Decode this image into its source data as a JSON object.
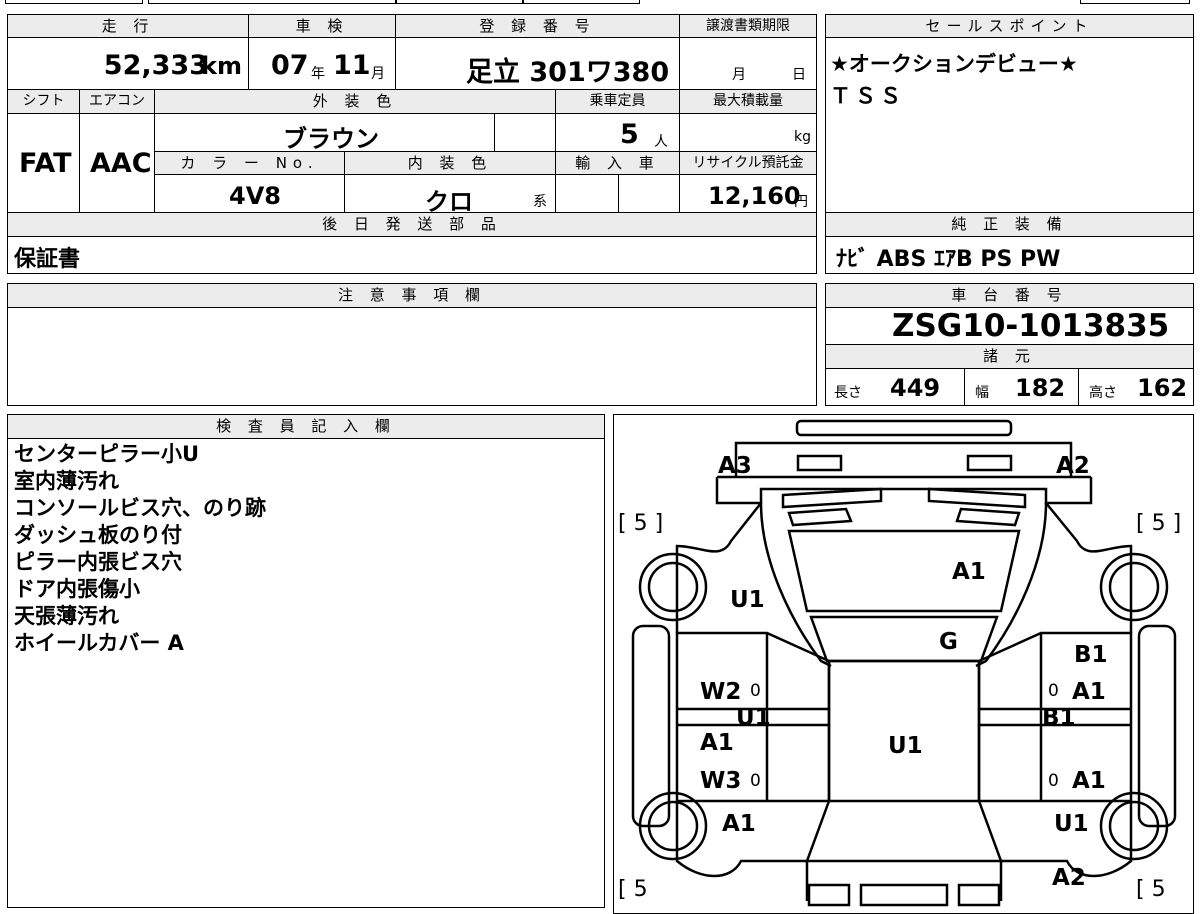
{
  "headers": {
    "mileage": "走 行",
    "inspection": "車 検",
    "registration": "登 録 番 号",
    "transfer_deadline": "譲渡書類期限",
    "sales_points": "セールスポイント",
    "shift": "シフト",
    "aircon": "エアコン",
    "exterior_color": "外 装 色",
    "capacity": "乗車定員",
    "max_load": "最大積載量",
    "color_no": "カ ラ ー No.",
    "interior_color": "内 装 色",
    "import": "輸 入 車",
    "recycle": "リサイクル預託金",
    "later_parts": "後 日 発 送 部 品",
    "genuine_equipment": "純 正 装 備",
    "notes": "注 意 事 項 欄",
    "chassis_number": "車 台 番 号",
    "specs": "諸 元",
    "inspector_notes": "検 査 員 記 入 欄"
  },
  "vehicle": {
    "mileage": "52,333",
    "mileage_unit": "km",
    "inspection_year": "07",
    "year_unit": "年",
    "inspection_month": "11",
    "month_unit": "月",
    "registration": "足立 301ワ380",
    "deadline_month_unit": "月",
    "deadline_day_unit": "日",
    "shift": "FAT",
    "aircon": "AAC",
    "exterior_color": "ブラウン",
    "capacity": "5",
    "capacity_unit": "人",
    "max_load_unit": "kg",
    "color_no": "4V8",
    "interior_color": "クロ",
    "interior_suffix": "系",
    "recycle_fee": "12,160",
    "recycle_unit": "円",
    "later_parts": "保証書",
    "chassis_number": "ZSG10-1013835",
    "length_label": "長さ",
    "length": "449",
    "width_label": "幅",
    "width": "182",
    "height_label": "高さ",
    "height": "162"
  },
  "sales_points": [
    "★オークションデビュー★",
    "ＴＳＳ"
  ],
  "equipment": "ﾅﾋﾞ ABS ｴｱB PS PW",
  "inspector_notes": [
    "センターピラー小U",
    "室内薄汚れ",
    "コンソールビス穴、のり跡",
    "ダッシュ板のり付",
    "ピラー内張ビス穴",
    "ドア内張傷小",
    "天張薄汚れ",
    "ホイールカバー A"
  ],
  "diagram": {
    "labels": {
      "rear_left": "A3",
      "rear_right": "A2",
      "rear_glass": "A1",
      "left_quarter": "U1",
      "roof": "G",
      "right_rear_door": "B1",
      "right_rear_door_2": "A1",
      "right_pillar": "B1",
      "left_rear_door": "W2",
      "left_pillar": "U1",
      "left_front_door": "A1",
      "left_front_door_2": "W3",
      "cabin": "U1",
      "right_front_door": "A1",
      "left_front_fender": "A1",
      "right_front_fender": "U1",
      "front_right": "A2"
    },
    "tire_tl": "[ 5 ]",
    "tire_tr": "[ 5 ]",
    "tire_bl": "[ 5",
    "tire_br": "[ 5",
    "zero": "0"
  }
}
